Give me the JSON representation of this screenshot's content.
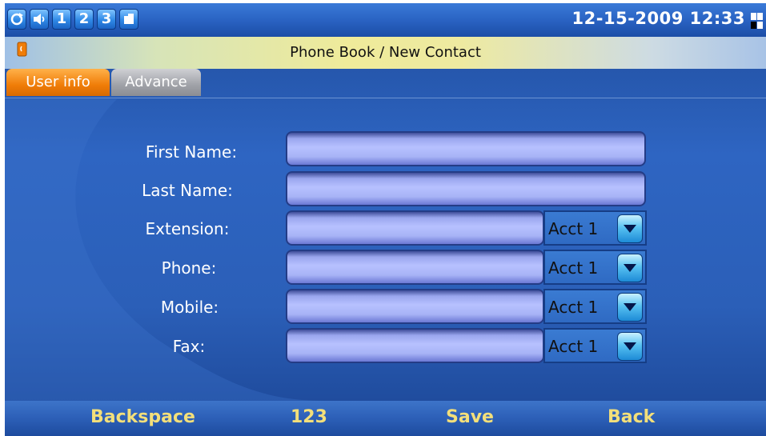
{
  "status": {
    "icons": [
      {
        "name": "refresh-icon",
        "text": ""
      },
      {
        "name": "speaker-icon",
        "text": ""
      },
      {
        "name": "line-1-icon",
        "text": "1"
      },
      {
        "name": "line-2-icon",
        "text": "2"
      },
      {
        "name": "line-3-icon",
        "text": "3"
      },
      {
        "name": "sim-card-icon",
        "text": ""
      }
    ],
    "datetime": "12-15-2009 12:33"
  },
  "header": {
    "title": "Phone Book / New Contact"
  },
  "tabs": {
    "user_info": "User info",
    "advance": "Advance",
    "active": "User info"
  },
  "form": {
    "first_name": {
      "label": "First Name:",
      "value": ""
    },
    "last_name": {
      "label": "Last Name:",
      "value": ""
    },
    "extension": {
      "label": "Extension:",
      "value": "",
      "account": "Acct 1"
    },
    "phone": {
      "label": "Phone:",
      "value": "",
      "account": "Acct 1"
    },
    "mobile": {
      "label": "Mobile:",
      "value": "",
      "account": "Acct 1"
    },
    "fax": {
      "label": "Fax:",
      "value": "",
      "account": "Acct 1"
    }
  },
  "softkeys": {
    "backspace": "Backspace",
    "input_mode": "123",
    "save": "Save",
    "back": "Back"
  },
  "colors": {
    "accent": "#f07d08",
    "softkey_text": "#f3df7a",
    "background": "#2b5fb8"
  }
}
